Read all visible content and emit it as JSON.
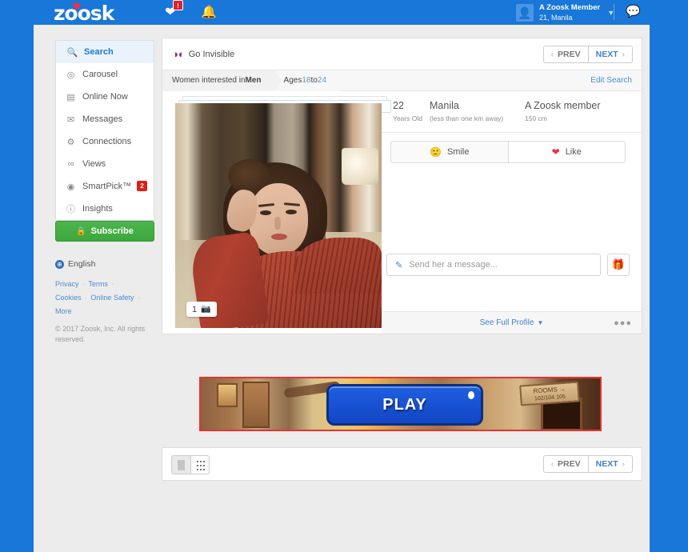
{
  "header": {
    "logo": "zoosk",
    "chat_badge": "!",
    "account_name": "A Zoosk Member",
    "account_sub": "21, Manila",
    "caret": "▼",
    "icons": {
      "chat": "♥",
      "bell": "🔔",
      "message": "💬",
      "avatar": "👤"
    }
  },
  "sidebar": {
    "items": [
      {
        "label": "Search",
        "icon": "🔍",
        "active": true,
        "badge": ""
      },
      {
        "label": "Carousel",
        "icon": "◎",
        "active": false,
        "badge": ""
      },
      {
        "label": "Online Now",
        "icon": "▤",
        "active": false,
        "badge": ""
      },
      {
        "label": "Messages",
        "icon": "✉",
        "active": false,
        "badge": ""
      },
      {
        "label": "Connections",
        "icon": "⚱",
        "active": false,
        "badge": ""
      },
      {
        "label": "Views",
        "icon": "∞",
        "active": false,
        "badge": ""
      },
      {
        "label": "SmartPick™",
        "icon": "◉",
        "active": false,
        "badge": "2"
      },
      {
        "label": "Insights",
        "icon": "ⓘ",
        "active": false,
        "badge": ""
      }
    ],
    "subscribe": {
      "label": "Subscribe",
      "icon": "🔒",
      "color": "#3da73d"
    },
    "language": {
      "label": "English",
      "icon": "⊕"
    },
    "legal_links": [
      "Privacy",
      "Terms",
      "Cookies",
      "Online Safety",
      "More"
    ],
    "copyright": "© 2017 Zoosk, Inc. All rights reserved."
  },
  "toolbar": {
    "go_invisible": "Go Invisible",
    "mask_icon": "◑◐",
    "prev": "PREV",
    "next": "NEXT",
    "chev_left": "‹",
    "chev_right": "›"
  },
  "filters": {
    "crumb1_pre": "Women interested in ",
    "crumb1_bold": "Men",
    "crumb2_pre": "Ages ",
    "crumb2_from": "18",
    "crumb2_mid": " to ",
    "crumb2_to": "24",
    "edit_search": "Edit Search"
  },
  "profile": {
    "photo_count": "1",
    "camera_icon": "📷",
    "age": "22",
    "age_label": "Years Old",
    "city": "Manila",
    "distance": "(less than one km away)",
    "member": "A Zoosk member",
    "height": "150 cm",
    "smile_label": "Smile",
    "smile_icon": "🙂",
    "like_label": "Like",
    "like_icon": "♥",
    "message_placeholder": "Send her a message...",
    "pencil_icon": "✎",
    "gift_icon": "🎁",
    "see_full_profile": "See Full Profile",
    "see_caret": "▼",
    "more_dots": "●●●"
  },
  "ad": {
    "play_label": "PLAY",
    "sign_line1": "ROOMS →",
    "sign_line2": "102/104 105",
    "border_color": "#e8332e"
  },
  "bottombar": {
    "prev": "PREV",
    "next": "NEXT",
    "chev_left": "‹",
    "chev_right": "›",
    "view_single": "single-view",
    "view_grid": "grid-view"
  }
}
